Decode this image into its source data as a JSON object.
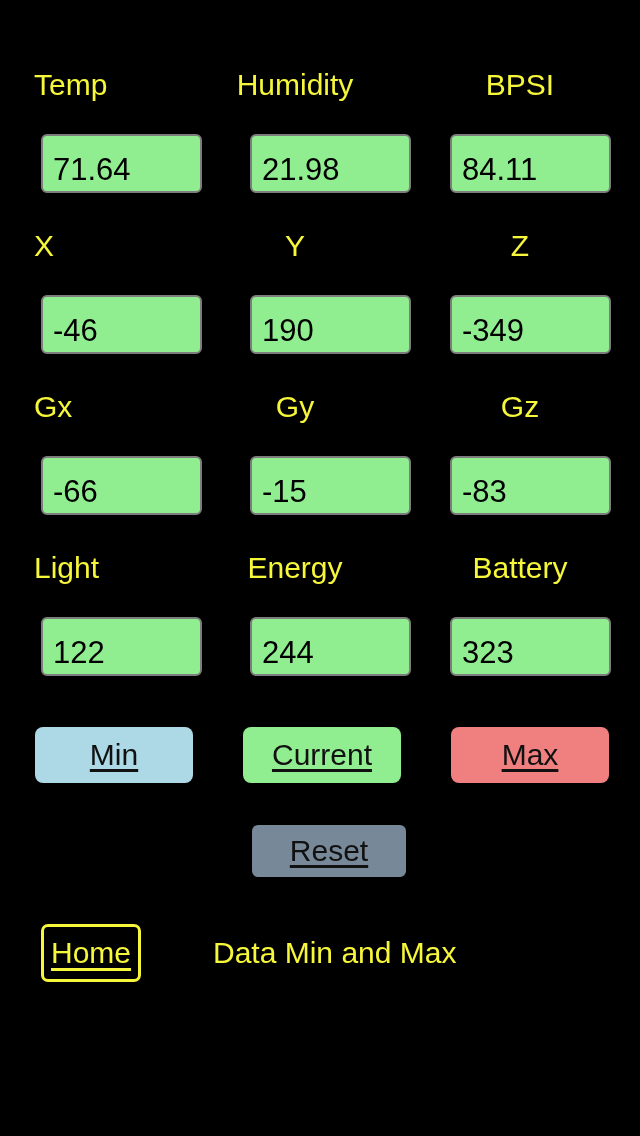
{
  "readings": [
    {
      "label": "Temp",
      "value": "71.64"
    },
    {
      "label": "Humidity",
      "value": "21.98"
    },
    {
      "label": "BPSI",
      "value": "84.11"
    },
    {
      "label": "X",
      "value": "-46"
    },
    {
      "label": "Y",
      "value": "190"
    },
    {
      "label": "Z",
      "value": "-349"
    },
    {
      "label": "Gx",
      "value": "-66"
    },
    {
      "label": "Gy",
      "value": "-15"
    },
    {
      "label": "Gz",
      "value": "-83"
    },
    {
      "label": "Light",
      "value": "122"
    },
    {
      "label": "Energy",
      "value": "244"
    },
    {
      "label": "Battery",
      "value": "323"
    }
  ],
  "range_buttons": [
    {
      "label": "Min",
      "color": "#add8e6"
    },
    {
      "label": "Current",
      "color": "#90ee90"
    },
    {
      "label": "Max",
      "color": "#f08080"
    }
  ],
  "reset_button": {
    "label": "Reset",
    "color": "#778899"
  },
  "footer": {
    "home_link": "Home",
    "title": "Data Min and Max"
  }
}
